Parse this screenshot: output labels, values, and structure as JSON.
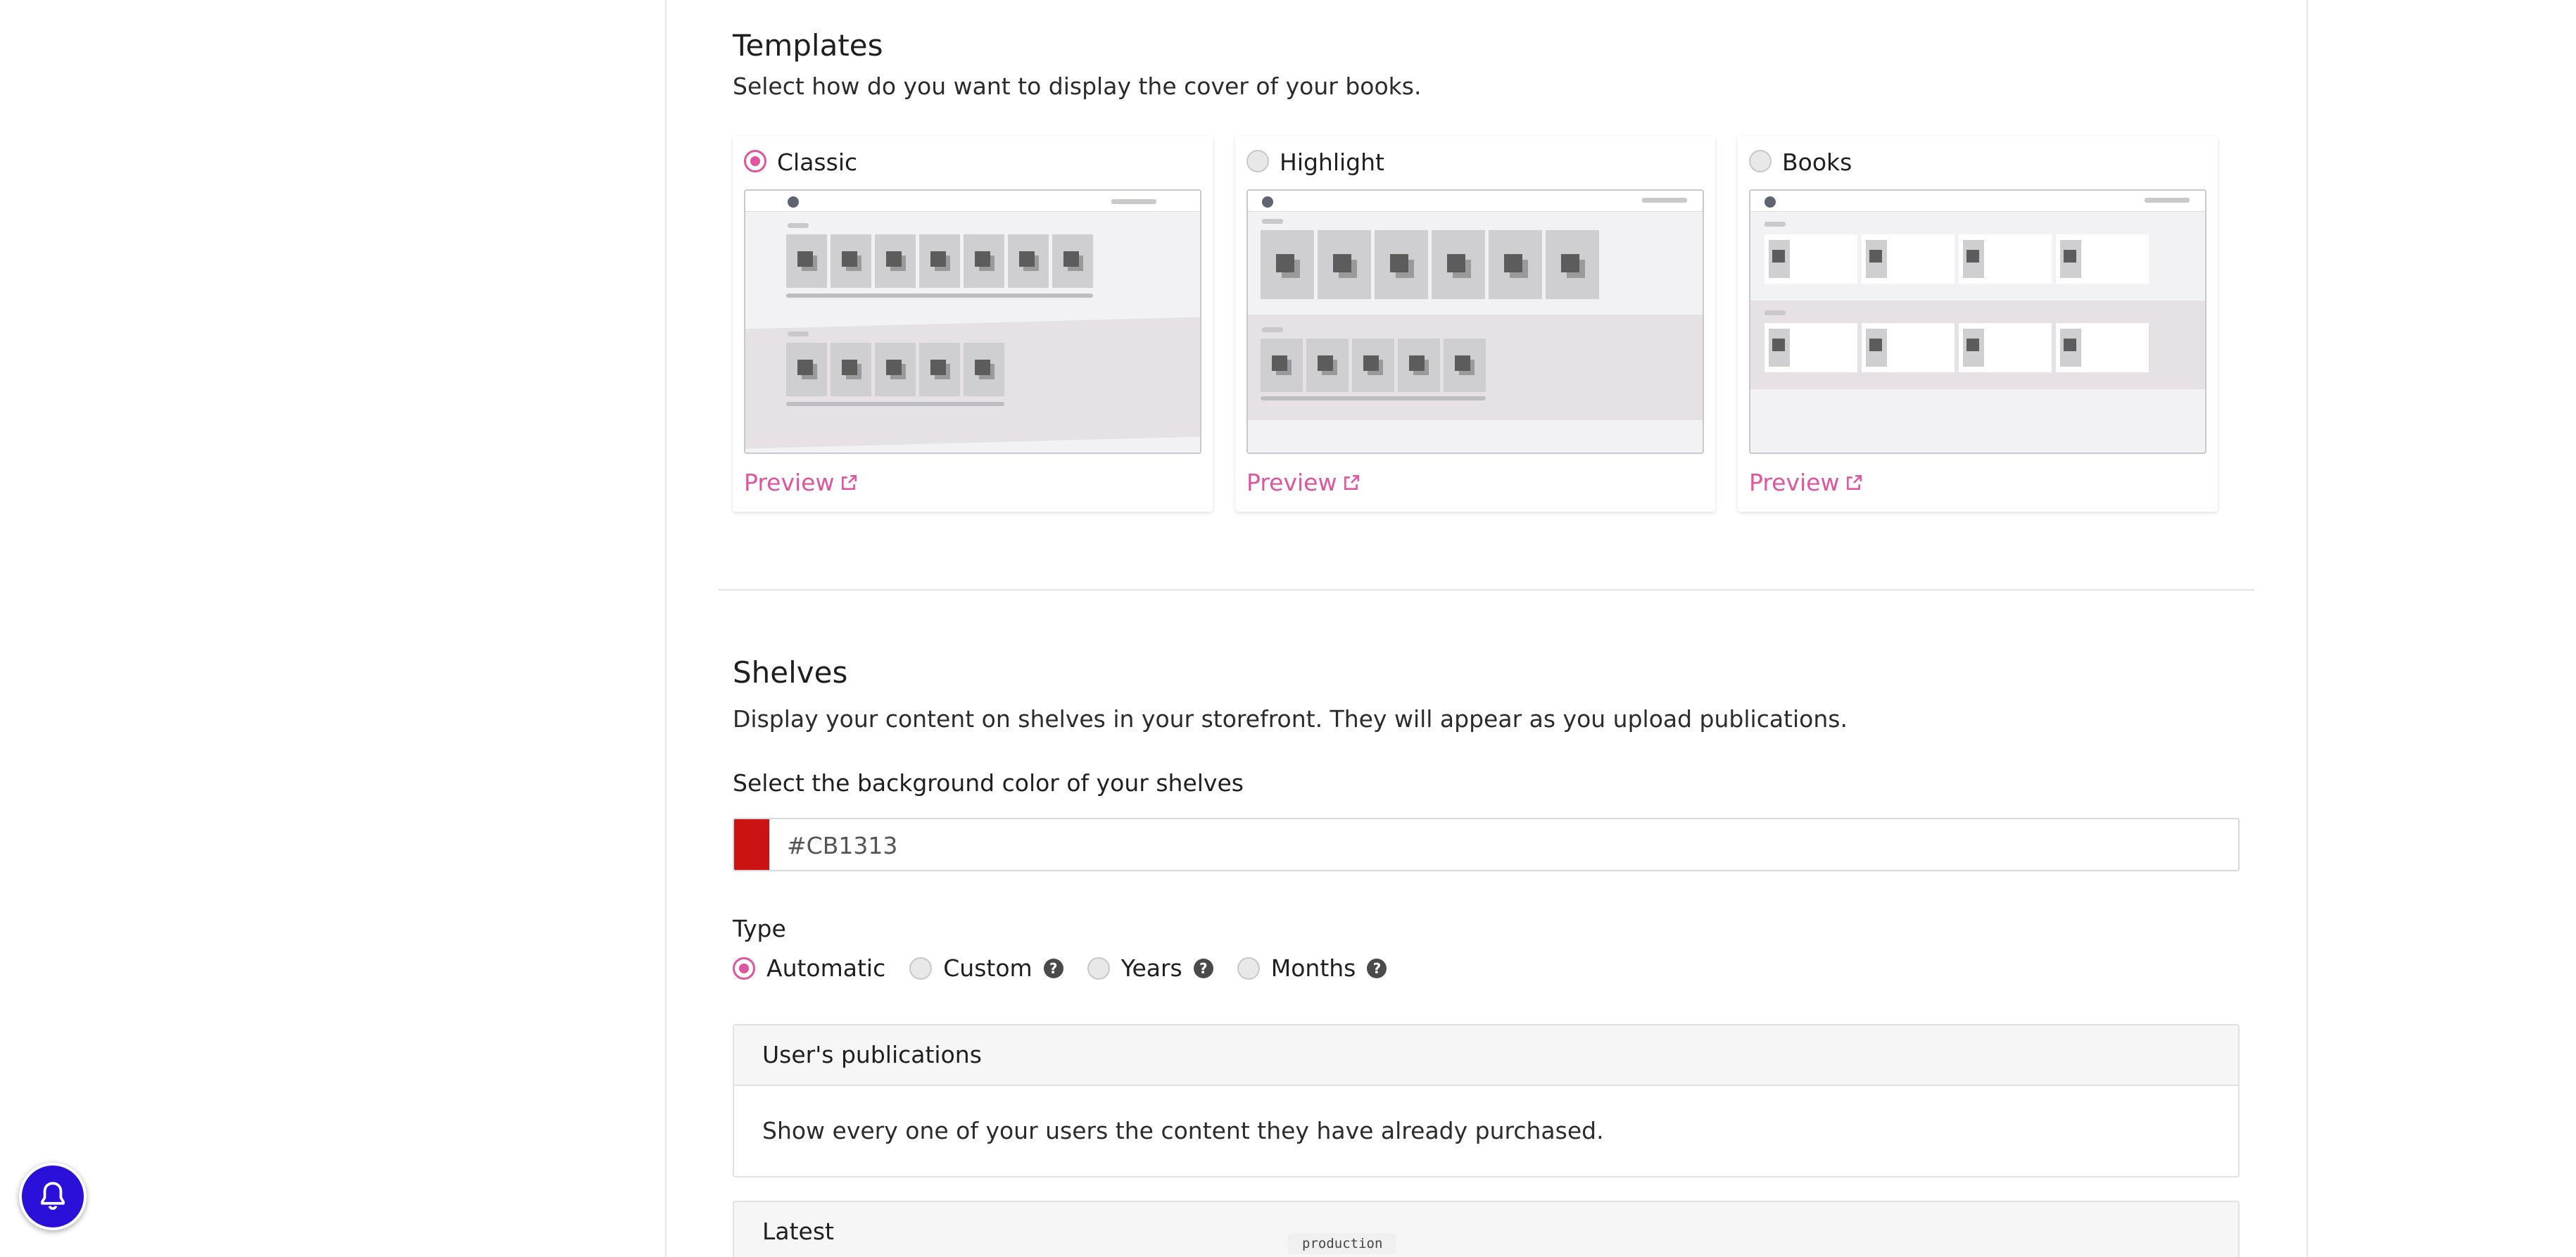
{
  "templates": {
    "title": "Templates",
    "subtitle": "Select how do you want to display the cover of your books.",
    "options": [
      {
        "label": "Classic",
        "selected": true,
        "preview_label": "Preview"
      },
      {
        "label": "Highlight",
        "selected": false,
        "preview_label": "Preview"
      },
      {
        "label": "Books",
        "selected": false,
        "preview_label": "Preview"
      }
    ]
  },
  "shelves": {
    "title": "Shelves",
    "subtitle": "Display your content on shelves in your storefront. They will appear as you upload publications.",
    "bg_color_label": "Select the background color of your shelves",
    "bg_color_value": "#CB1313",
    "type_label": "Type",
    "type_options": [
      {
        "label": "Automatic",
        "selected": true,
        "help": false
      },
      {
        "label": "Custom",
        "selected": false,
        "help": true
      },
      {
        "label": "Years",
        "selected": false,
        "help": true
      },
      {
        "label": "Months",
        "selected": false,
        "help": true
      }
    ],
    "panels": [
      {
        "title": "User's publications",
        "text": "Show every one of your users the content they have already purchased."
      },
      {
        "title": "Latest",
        "text": ""
      }
    ]
  },
  "env_badge": "production",
  "colors": {
    "accent": "#e0559f",
    "notify_button": "#2a10d8",
    "shelf_color": "#CB1313"
  },
  "icons": {
    "external_link": "external-link-icon",
    "help": "help-icon",
    "bell": "bell-icon"
  },
  "help_glyph": "?"
}
